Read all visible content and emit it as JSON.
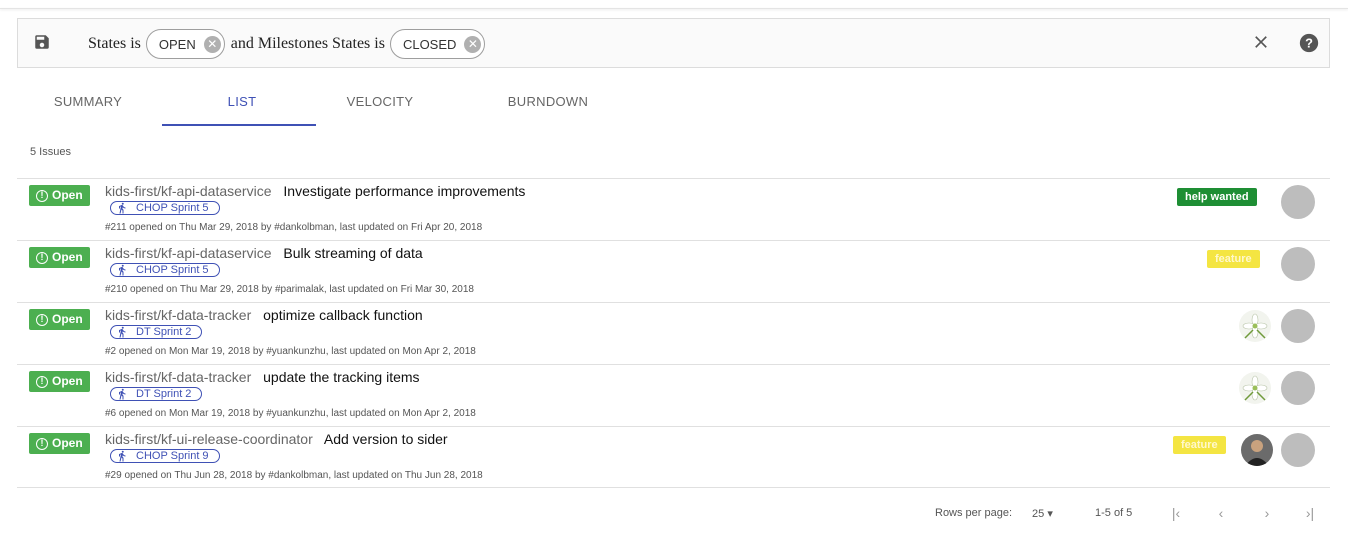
{
  "filter": {
    "prefix": "States is",
    "chip1": "OPEN",
    "middle": "and Milestones States is",
    "chip2": "CLOSED"
  },
  "tabs": [
    {
      "label": "SUMMARY"
    },
    {
      "label": "LIST"
    },
    {
      "label": "VELOCITY"
    },
    {
      "label": "BURNDOWN"
    }
  ],
  "issue_count": "5 Issues",
  "issues": [
    {
      "state": "Open",
      "repo": "kids-first/kf-api-dataservice",
      "title": "Investigate performance improvements",
      "milestone": "CHOP Sprint 5",
      "meta": "#211 opened on Thu Mar 29, 2018 by #dankolbman, last updated on Fri Apr 20, 2018",
      "label": "help wanted"
    },
    {
      "state": "Open",
      "repo": "kids-first/kf-api-dataservice",
      "title": "Bulk streaming of data",
      "milestone": "CHOP Sprint 5",
      "meta": "#210 opened on Thu Mar 29, 2018 by #parimalak, last updated on Fri Mar 30, 2018",
      "label": "feature"
    },
    {
      "state": "Open",
      "repo": "kids-first/kf-data-tracker",
      "title": "optimize callback function",
      "milestone": "DT Sprint 2",
      "meta": "#2 opened on Mon Mar 19, 2018 by #yuankunzhu, last updated on Mon Apr 2, 2018",
      "label": ""
    },
    {
      "state": "Open",
      "repo": "kids-first/kf-data-tracker",
      "title": "update the tracking items",
      "milestone": "DT Sprint 2",
      "meta": "#6 opened on Mon Mar 19, 2018 by #yuankunzhu, last updated on Mon Apr 2, 2018",
      "label": ""
    },
    {
      "state": "Open",
      "repo": "kids-first/kf-ui-release-coordinator",
      "title": "Add version to sider",
      "milestone": "CHOP Sprint 9",
      "meta": "#29 opened on Thu Jun 28, 2018 by #dankolbman, last updated on Thu Jun 28, 2018",
      "label": "feature"
    }
  ],
  "pagination": {
    "rows_label": "Rows per page:",
    "rows_value": "25",
    "range": "1-5 of 5"
  },
  "colors": {
    "accent": "#3f51b5",
    "open_badge": "#4caf50",
    "help_wanted": "#1e8e34",
    "feature": "#f4e542"
  }
}
